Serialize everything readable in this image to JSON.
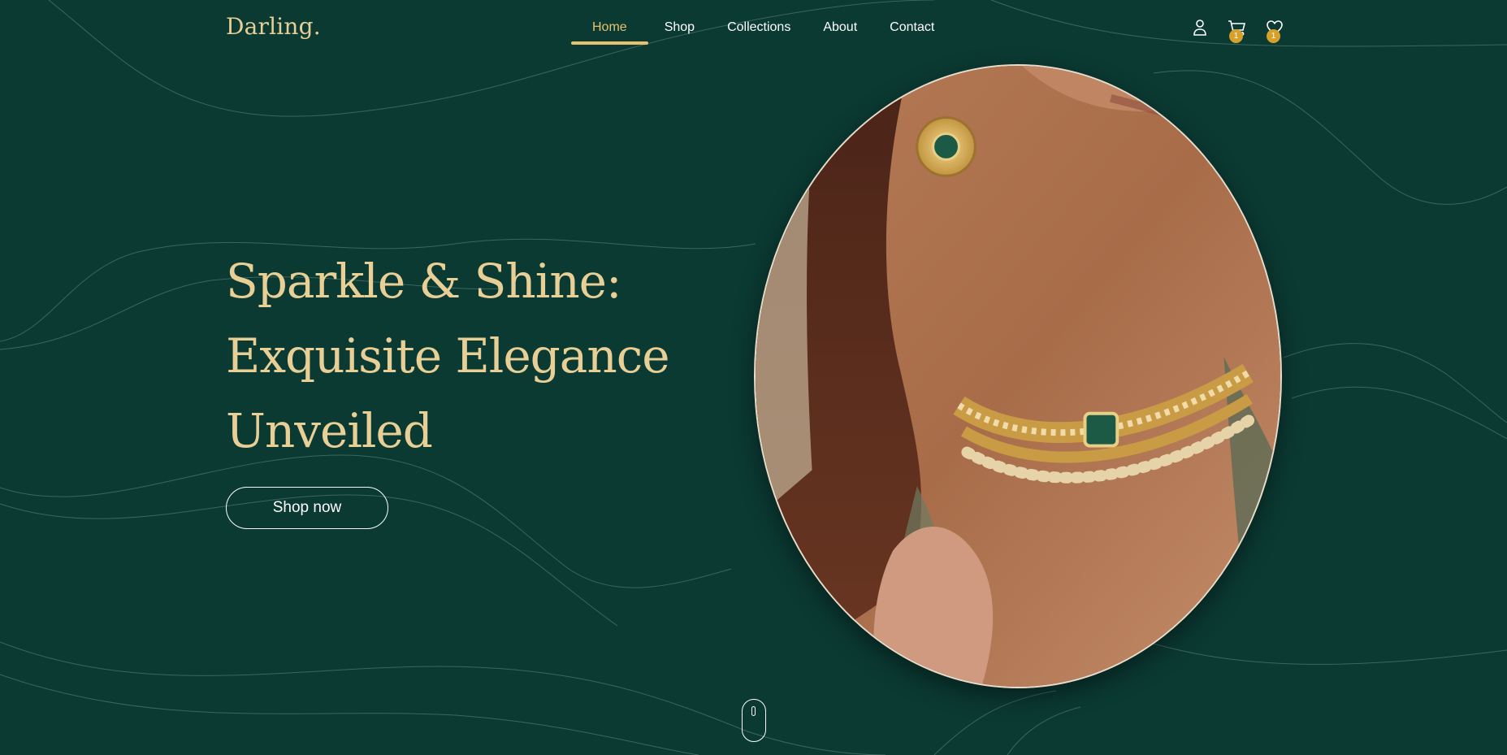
{
  "brand": {
    "logo": "Darling."
  },
  "nav": {
    "items": [
      {
        "label": "Home",
        "active": true
      },
      {
        "label": "Shop",
        "active": false
      },
      {
        "label": "Collections",
        "active": false
      },
      {
        "label": "About",
        "active": false
      },
      {
        "label": "Contact",
        "active": false
      }
    ]
  },
  "header_icons": {
    "user": {
      "icon": "user-icon"
    },
    "cart": {
      "icon": "cart-icon",
      "count": "1"
    },
    "wishlist": {
      "icon": "heart-icon",
      "count": "1"
    }
  },
  "hero": {
    "title_lines": [
      "Sparkle & Shine:",
      "Exquisite Elegance",
      "Unveiled"
    ],
    "cta_label": "Shop now",
    "image": {
      "description": ""
    }
  },
  "scroll_indicator": {
    "icon": "mouse-scroll-icon"
  },
  "colors": {
    "background": "#0b3a33",
    "accent_gold": "#e6c16e",
    "title_cream": "#e8cf96",
    "badge": "#d6a12a"
  }
}
